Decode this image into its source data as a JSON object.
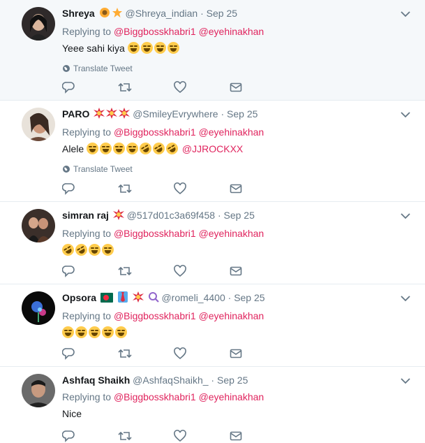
{
  "translate_label": "Translate Tweet",
  "colors": {
    "mention": "#e0245e",
    "muted": "#657786",
    "highlight_bg": "#f5f8fa"
  },
  "tweets": [
    {
      "name": "Shreya",
      "badges": [
        "sunflower-emoji",
        "star-emoji"
      ],
      "handle": "@Shreya_indian",
      "time": "Sep 25",
      "replying_prefix": "Replying to",
      "replying_to": [
        "@Biggbosskhabri1",
        "@eyehinakhan"
      ],
      "text": "Yeee sahi kiya",
      "emojis": [
        "joy",
        "joy",
        "joy",
        "joy"
      ],
      "has_translate": true
    },
    {
      "name": "PARO",
      "badges": [
        "collision-emoji",
        "collision-emoji",
        "collision-emoji"
      ],
      "handle": "@SmileyEvrywhere",
      "time": "Sep 25",
      "replying_prefix": "Replying to",
      "replying_to": [
        "@Biggbosskhabri1",
        "@eyehinakhan"
      ],
      "text": "Alele",
      "emojis": [
        "joy",
        "joy",
        "joy",
        "joy",
        "rofl",
        "rofl",
        "rofl"
      ],
      "text_mention": "@JJROCKXX",
      "has_translate": true
    },
    {
      "name": "simran raj",
      "badges": [
        "collision-emoji"
      ],
      "handle": "@517d01c3a69f458",
      "time": "Sep 25",
      "replying_prefix": "Replying to",
      "replying_to": [
        "@Biggbosskhabri1",
        "@eyehinakhan"
      ],
      "text": "",
      "emojis": [
        "rofl",
        "rofl",
        "joy",
        "joy"
      ],
      "has_translate": false
    },
    {
      "name": "Opsora",
      "badges": [
        "bangladesh-flag-emoji",
        "necktie-emoji",
        "collision-emoji",
        "magnifier-emoji"
      ],
      "handle": "@romeli_4400",
      "time": "Sep 25",
      "replying_prefix": "Replying to",
      "replying_to": [
        "@Biggbosskhabri1",
        "@eyehinakhan"
      ],
      "text": "",
      "emojis": [
        "joy",
        "joy",
        "joy",
        "joy",
        "joy"
      ],
      "has_translate": false
    },
    {
      "name": "Ashfaq Shaikh",
      "badges": [],
      "handle": "@AshfaqShaikh_",
      "time": "Sep 25",
      "replying_prefix": "Replying to",
      "replying_to": [
        "@Biggbosskhabri1",
        "@eyehinakhan"
      ],
      "text": "Nice",
      "emojis": [],
      "has_translate": false
    }
  ],
  "action_icons": [
    "reply-icon",
    "retweet-icon",
    "like-icon",
    "dm-icon"
  ]
}
